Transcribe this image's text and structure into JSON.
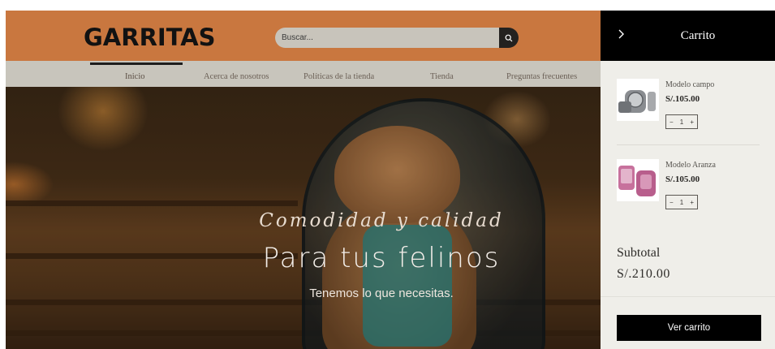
{
  "site": {
    "logo": "GARRITAS",
    "search": {
      "placeholder": "Buscar..."
    },
    "nav": {
      "items": [
        {
          "label": "Inicio",
          "active": true
        },
        {
          "label": "Acerca de nosotros",
          "active": false
        },
        {
          "label": "Políticas de la tienda",
          "active": false
        },
        {
          "label": "Tienda",
          "active": false
        },
        {
          "label": "Preguntas frecuentes",
          "active": false
        }
      ]
    },
    "hero": {
      "kicker": "Comodidad y calidad",
      "title": "Para tus felinos",
      "subtitle": "Tenemos lo que necesitas."
    },
    "colors": {
      "header": "#c9773f",
      "nav": "#c8c5bc",
      "search_button": "#23211f"
    }
  },
  "cart": {
    "title": "Carrito",
    "close_icon": "chevron-right-icon",
    "items": [
      {
        "name": "Modelo campo",
        "price": "S/.105.00",
        "quantity": "1",
        "image_icon": "gray-cat-backpack-image"
      },
      {
        "name": "Modelo Aranza",
        "price": "S/.105.00",
        "quantity": "1",
        "image_icon": "pink-cat-backpack-image"
      }
    ],
    "subtotal_label": "Subtotal",
    "subtotal_value": "S/.210.00",
    "view_cart_label": "Ver carrito",
    "colors": {
      "header": "#000000",
      "panel": "#efeee9",
      "button": "#000000"
    }
  }
}
